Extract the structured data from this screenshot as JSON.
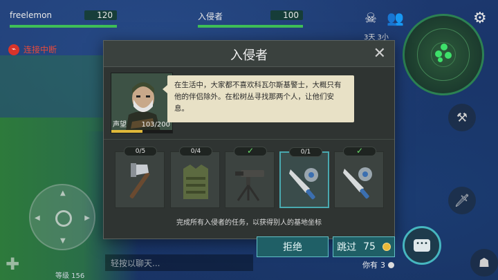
{
  "players": [
    {
      "name": "freelemon",
      "value": "120",
      "fill": 1.0
    },
    {
      "name": "入侵者",
      "value": "100",
      "fill": 1.0
    }
  ],
  "connection": {
    "text": "连接中断"
  },
  "hud": {
    "day_label": "3天 3小",
    "level": "等级 156",
    "chat_placeholder": "轻按以聊天..."
  },
  "modal": {
    "title": "入侵者",
    "close_icon": "close-icon",
    "portrait": {
      "reputation_label": "声望",
      "reputation_value": "103/200",
      "reputation_fraction": 0.515
    },
    "speech": "在生活中，大家都不喜欢科瓦尔斯基警士，大概只有他的伴侣除外。在松树丛寻找那两个人，让他们安息。",
    "tasks": [
      {
        "badge": "0/5",
        "done": false,
        "icon": "hatchet-icon"
      },
      {
        "badge": "0/4",
        "done": false,
        "icon": "vest-icon"
      },
      {
        "badge": "✓",
        "done": true,
        "icon": "turret-icon"
      },
      {
        "badge": "0/1",
        "done": false,
        "icon": "sawblade-machete-icon",
        "active": true
      },
      {
        "badge": "✓",
        "done": true,
        "icon": "sawblade-machete-icon"
      }
    ],
    "hint": "完成所有入侵者的任务，以获得别人的基地坐标"
  },
  "buttons": {
    "refuse": "拒绝",
    "skip": "跳过",
    "skip_cost": "75"
  },
  "currency": {
    "have_label": "你有",
    "have_value": "3"
  },
  "colors": {
    "accent": "#49a9b0",
    "health": "#3fbf57",
    "coin": "#e9b93a",
    "speech_bg": "#e8e1c6"
  }
}
